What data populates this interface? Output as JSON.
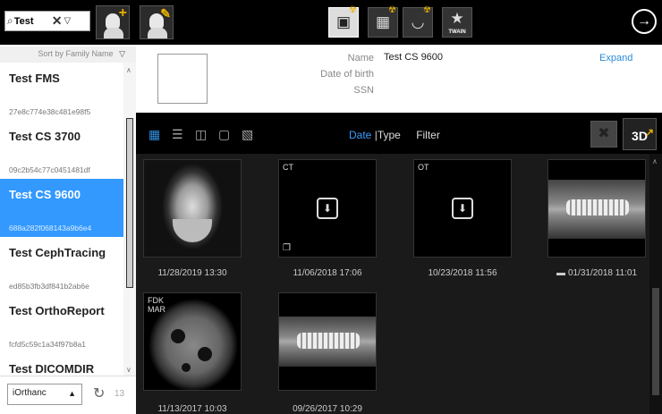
{
  "search": {
    "value": "Test"
  },
  "sort": {
    "label": "Sort by Family Name"
  },
  "patients": [
    {
      "name": "Test FMS",
      "id": "27e8c774e38c481e98f5"
    },
    {
      "name": "Test CS 3700",
      "id": "09c2b54c77c0451481df"
    },
    {
      "name": "Test CS 9600",
      "id": "688a282f068143a9b6e4"
    },
    {
      "name": "Test CephTracing",
      "id": "ed85b3fb3df841b2ab6e"
    },
    {
      "name": "Test OrthoReport",
      "id": "fcfd5c59c1a34f97b8a1"
    },
    {
      "name": "Test DICOMDIR",
      "id": ""
    }
  ],
  "server": {
    "selected": "iOrthanc",
    "count": "13"
  },
  "toolbar": {
    "twain_label": "TWAIN"
  },
  "patient": {
    "name_label": "Name",
    "name_value": "Test CS 9600",
    "dob_label": "Date of birth",
    "ssn_label": "SSN",
    "expand_label": "Expand"
  },
  "gallery_toolbar": {
    "date": "Date",
    "sep": "|",
    "type": "Type",
    "filter": "Filter",
    "threeD": "3D"
  },
  "studies": [
    {
      "tag": "",
      "date": "11/28/2019 13:30"
    },
    {
      "tag": "CT",
      "date": "11/06/2018 17:06"
    },
    {
      "tag": "OT",
      "date": "10/23/2018 11:56"
    },
    {
      "tag": "",
      "date": "01/31/2018 11:01"
    },
    {
      "tag": "FDK\nMAR",
      "date": "11/13/2017 10:03"
    },
    {
      "tag": "",
      "date": "09/26/2017 10:29"
    }
  ],
  "icons": [
    "search-icon",
    "clear-icon",
    "filter-icon",
    "add-patient-icon",
    "edit-patient-icon",
    "intraoral-icon",
    "layout-icon",
    "panoramic-icon",
    "twain-icon",
    "next-icon",
    "grid-view-icon",
    "list-view-icon",
    "compare-view-icon",
    "monitor-view-icon",
    "mount-view-icon",
    "trash-icon",
    "3d-icon",
    "download-icon",
    "refresh-icon"
  ],
  "colors": {
    "accent": "#3399ff",
    "link": "#2a8ad8",
    "highlight": "#e8b000"
  }
}
